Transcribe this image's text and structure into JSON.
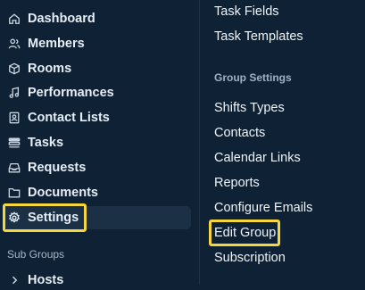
{
  "sidebar": {
    "items": [
      {
        "label": "Dashboard",
        "icon": "home-icon"
      },
      {
        "label": "Members",
        "icon": "members-icon"
      },
      {
        "label": "Rooms",
        "icon": "cube-icon"
      },
      {
        "label": "Performances",
        "icon": "music-note-icon"
      },
      {
        "label": "Contact Lists",
        "icon": "contact-card-icon"
      },
      {
        "label": "Tasks",
        "icon": "tasks-icon"
      },
      {
        "label": "Requests",
        "icon": "inbox-icon"
      },
      {
        "label": "Documents",
        "icon": "folder-icon"
      },
      {
        "label": "Settings",
        "icon": "gear-icon"
      }
    ],
    "subgroups_label": "Sub Groups",
    "subgroups": [
      {
        "label": "Hosts",
        "icon": "chevron-right-icon"
      }
    ]
  },
  "settings_panel": {
    "top_items": [
      "Task Fields",
      "Task Templates"
    ],
    "section_title": "Group Settings",
    "items": [
      "Shifts Types",
      "Contacts",
      "Calendar Links",
      "Reports",
      "Configure Emails",
      "Edit Group",
      "Subscription"
    ]
  },
  "colors": {
    "background": "#0f2235",
    "active_item": "#1b2f45",
    "highlight": "#f5d63d"
  }
}
